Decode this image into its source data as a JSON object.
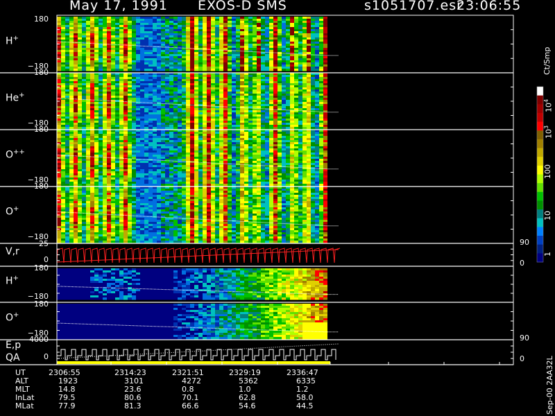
{
  "header": {
    "date": "May 17, 1991",
    "mission": "EXOS-D SMS",
    "file": "s1051707.esr",
    "time": "23:06:55"
  },
  "colorbar": {
    "unit": "Ct/Smp",
    "tick_labels": [
      "10",
      "10",
      "100",
      "10",
      "1"
    ],
    "tick_exps": [
      "4",
      "3",
      "",
      "",
      ""
    ],
    "colors": [
      "#ffffff",
      "#800000",
      "#a00000",
      "#c00000",
      "#ff0000",
      "#806000",
      "#a08000",
      "#c0a800",
      "#e0d000",
      "#ffff00",
      "#b0ff00",
      "#60e000",
      "#00c000",
      "#009000",
      "#008080",
      "#00c0c0",
      "#0080ff",
      "#0040c0",
      "#002080",
      "#000080"
    ]
  },
  "panels": [
    {
      "id": "h_plus",
      "label": "H",
      "sup": "+",
      "ymax": "180",
      "ymin": "−180"
    },
    {
      "id": "he_plus",
      "label": "He",
      "sup": "+",
      "ymax": "180",
      "ymin": "−180"
    },
    {
      "id": "o_plus_plus",
      "label": "O",
      "sup": "++",
      "ymax": "180",
      "ymin": "−180"
    },
    {
      "id": "o_plus",
      "label": "O",
      "sup": "+",
      "ymax": "180",
      "ymin": "−180"
    },
    {
      "id": "vr",
      "label": "V,r",
      "sup": "",
      "ymax": "25",
      "ymin": "0",
      "right_max": "90",
      "right_min": "0"
    },
    {
      "id": "h_plus_2",
      "label": "H",
      "sup": "+",
      "ymax": "180",
      "ymin": "−180"
    },
    {
      "id": "o_plus_2",
      "label": "O",
      "sup": "+",
      "ymax": "180",
      "ymin": "−180"
    },
    {
      "id": "ep",
      "label": "E,p",
      "label2": "QA",
      "sup": "",
      "ymax": "4000",
      "ymin": "0",
      "right_max": "90",
      "right_min": "0"
    }
  ],
  "ephemeris": {
    "rows": [
      {
        "name": "UT",
        "values": [
          "2306:55",
          "2314:23",
          "2321:51",
          "2329:19",
          "2336:47"
        ]
      },
      {
        "name": "ALT",
        "values": [
          "1923",
          "3101",
          "4272",
          "5362",
          "6335"
        ]
      },
      {
        "name": "MLT",
        "values": [
          "14.8",
          "23.6",
          "0.8",
          "1.0",
          "1.2"
        ]
      },
      {
        "name": "InLat",
        "values": [
          "79.5",
          "80.6",
          "70.1",
          "62.8",
          "58.0"
        ]
      },
      {
        "name": "MLat",
        "values": [
          "77.9",
          "81.3",
          "66.6",
          "54.6",
          "44.5"
        ]
      }
    ]
  },
  "side_stamp": "Sep-00 2AA32L",
  "chart_data": {
    "type": "heatmap",
    "title": "May 17, 1991   EXOS-D SMS",
    "xlabel": "UT",
    "x_ticks": [
      "2306:55",
      "2314:23",
      "2321:51",
      "2329:19",
      "2336:47"
    ],
    "colorbar_range": [
      1,
      10000
    ],
    "colorbar_scale": "log",
    "series": [
      {
        "name": "H+",
        "ylim": [
          -180,
          180
        ]
      },
      {
        "name": "He+",
        "ylim": [
          -180,
          180
        ]
      },
      {
        "name": "O++",
        "ylim": [
          -180,
          180
        ]
      },
      {
        "name": "O+",
        "ylim": [
          -180,
          180
        ]
      },
      {
        "name": "V,r",
        "ylim": [
          0,
          25
        ],
        "y2lim": [
          0,
          90
        ]
      },
      {
        "name": "H+",
        "ylim": [
          -180,
          180
        ]
      },
      {
        "name": "O+",
        "ylim": [
          -180,
          180
        ]
      },
      {
        "name": "E,p",
        "ylim": [
          0,
          4000
        ],
        "y2lim": [
          0,
          90
        ]
      }
    ]
  }
}
